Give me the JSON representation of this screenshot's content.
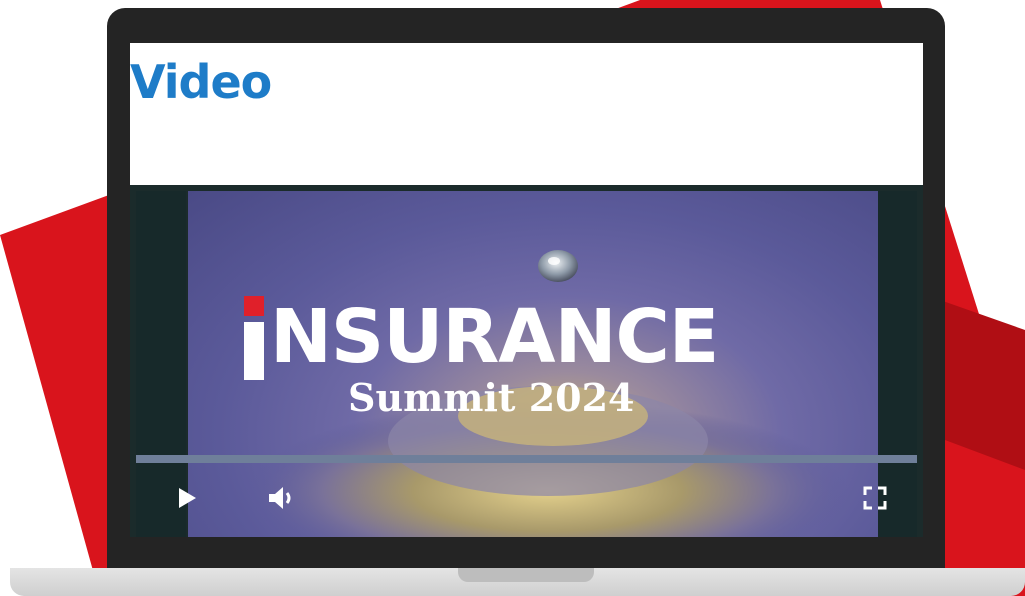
{
  "page": {
    "title": "Video"
  },
  "video": {
    "brand_word": "NSURANCE",
    "event_line": "Summit 2024",
    "progress": 0.0
  },
  "controls": {
    "play": "play-icon",
    "volume": "volume-icon",
    "fullscreen": "fullscreen-icon"
  },
  "colors": {
    "title_blue": "#1e7cc8",
    "brand_red": "#e0202a",
    "background_red": "#d9141c",
    "laptop_frame": "#242424"
  }
}
